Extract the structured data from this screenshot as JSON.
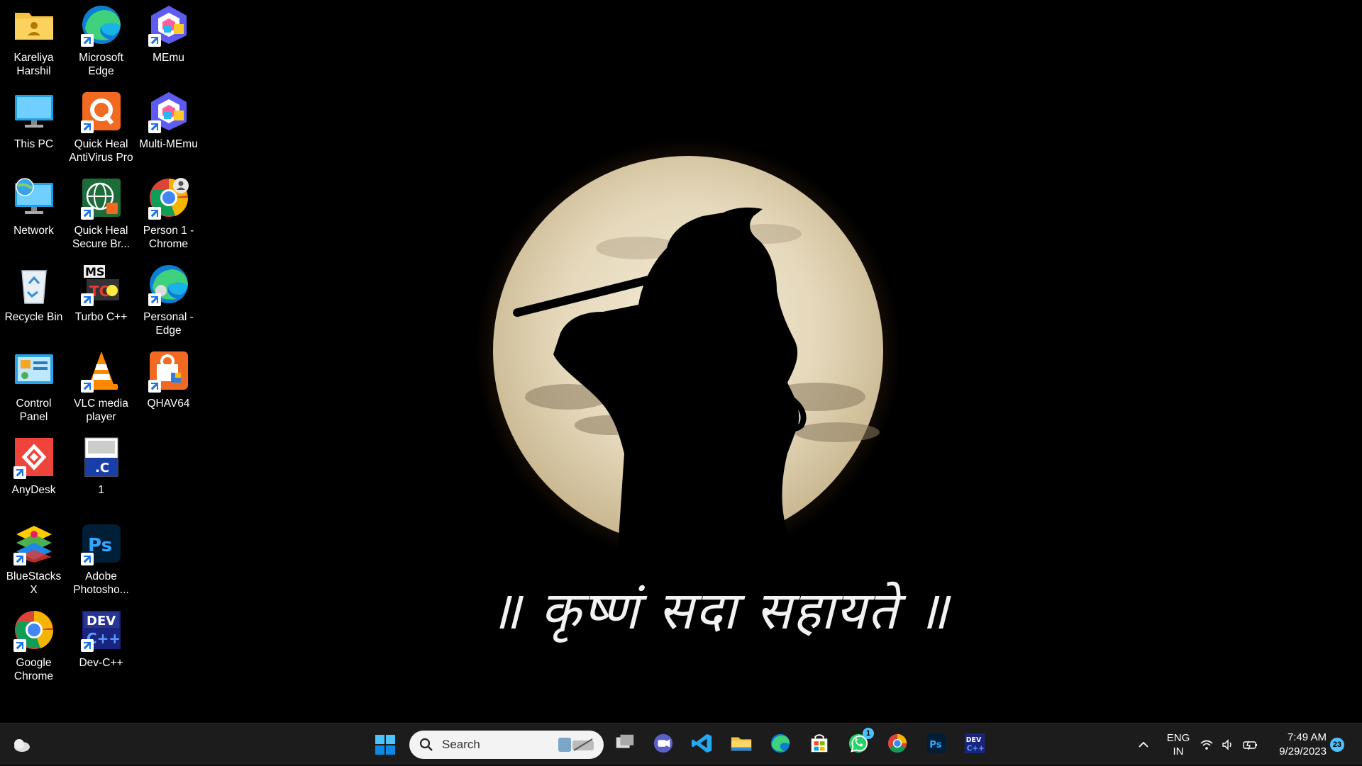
{
  "desktop": {
    "icons": [
      {
        "label": "Kareliya Harshil",
        "icon": "user-folder-icon",
        "shortcut": false
      },
      {
        "label": "Microsoft Edge",
        "icon": "edge-icon",
        "shortcut": true
      },
      {
        "label": "MEmu",
        "icon": "memu-icon",
        "shortcut": true
      },
      {
        "label": "This PC",
        "icon": "monitor-icon",
        "shortcut": false
      },
      {
        "label": "Quick Heal AntiVirus Pro",
        "icon": "quickheal-icon",
        "shortcut": true
      },
      {
        "label": "Multi-MEmu",
        "icon": "multi-memu-icon",
        "shortcut": true
      },
      {
        "label": "Network",
        "icon": "network-icon",
        "shortcut": false
      },
      {
        "label": "Quick Heal Secure Br...",
        "icon": "quickheal-browser-icon",
        "shortcut": true
      },
      {
        "label": "Person 1 - Chrome",
        "icon": "chrome-profile-icon",
        "shortcut": true
      },
      {
        "label": "Recycle Bin",
        "icon": "recycle-bin-icon",
        "shortcut": false
      },
      {
        "label": "Turbo C++",
        "icon": "turbo-cpp-icon",
        "shortcut": true
      },
      {
        "label": "Personal - Edge",
        "icon": "edge-profile-icon",
        "shortcut": true
      },
      {
        "label": "Control Panel",
        "icon": "control-panel-icon",
        "shortcut": false
      },
      {
        "label": "VLC media player",
        "icon": "vlc-icon",
        "shortcut": true
      },
      {
        "label": "QHAV64",
        "icon": "qhav64-icon",
        "shortcut": true
      },
      {
        "label": "AnyDesk",
        "icon": "anydesk-icon",
        "shortcut": true
      },
      {
        "label": "1",
        "icon": "c-file-icon",
        "shortcut": false
      },
      {
        "label": "",
        "icon": "",
        "shortcut": false
      },
      {
        "label": "BlueStacks X",
        "icon": "bluestacks-icon",
        "shortcut": true
      },
      {
        "label": "Adobe Photosho...",
        "icon": "photoshop-icon",
        "shortcut": true
      },
      {
        "label": "",
        "icon": "",
        "shortcut": false
      },
      {
        "label": "Google Chrome",
        "icon": "chrome-icon",
        "shortcut": true
      },
      {
        "label": "Dev-C++",
        "icon": "devcpp-icon",
        "shortcut": true
      }
    ]
  },
  "wallpaper": {
    "quote": "॥ कृष्णं सदा सहायते ॥"
  },
  "taskbar": {
    "search_placeholder": "Search",
    "pinned": [
      "start-icon",
      "task-view-icon",
      "teams-chat-icon",
      "vscode-icon",
      "file-explorer-icon",
      "edge-icon",
      "microsoft-store-icon",
      "whatsapp-icon",
      "chrome-icon",
      "photoshop-icon",
      "devcpp-icon"
    ],
    "whatsapp_badge": "1",
    "lang_line1": "ENG",
    "lang_line2": "IN",
    "time": "7:49 AM",
    "date": "9/29/2023",
    "notifications": "23"
  },
  "colors": {
    "taskbar_bg": "#1c1c1c",
    "accent": "#4cc2ff",
    "moon": "#e8dcc4"
  }
}
